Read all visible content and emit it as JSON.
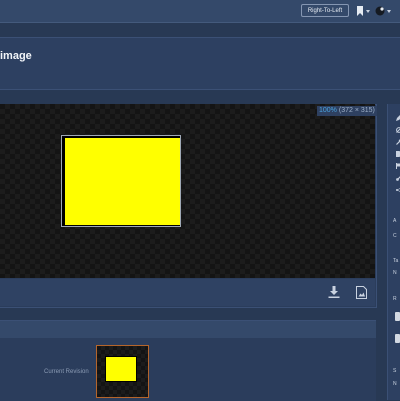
{
  "header": {
    "rtl_button_label": "Right-To-Left",
    "bookmark_icon": "bookmark-icon",
    "avatar_icon": "avatar-icon"
  },
  "page": {
    "title": "image"
  },
  "preview": {
    "zoom_percent": "100%",
    "dimensions": "(372 × 315)",
    "image_color": "#ffff00",
    "footer_icons": [
      "download-icon",
      "file-icon"
    ]
  },
  "right_panel": {
    "tool_icons": [
      "pencil-icon",
      "eye-off-icon",
      "wrench-icon",
      "tag-icon",
      "flag-icon",
      "link-icon",
      "share-icon"
    ],
    "label_1": "A",
    "label_2": "C",
    "label_3": "Ta",
    "label_4": "N",
    "label_5": "R",
    "label_6": "S",
    "label_7": "N"
  },
  "revisions": {
    "current_label": "Current Revision"
  },
  "colors": {
    "background": "#283954",
    "accent": "#4aa3df",
    "thumbnail_border": "#b5652b"
  }
}
